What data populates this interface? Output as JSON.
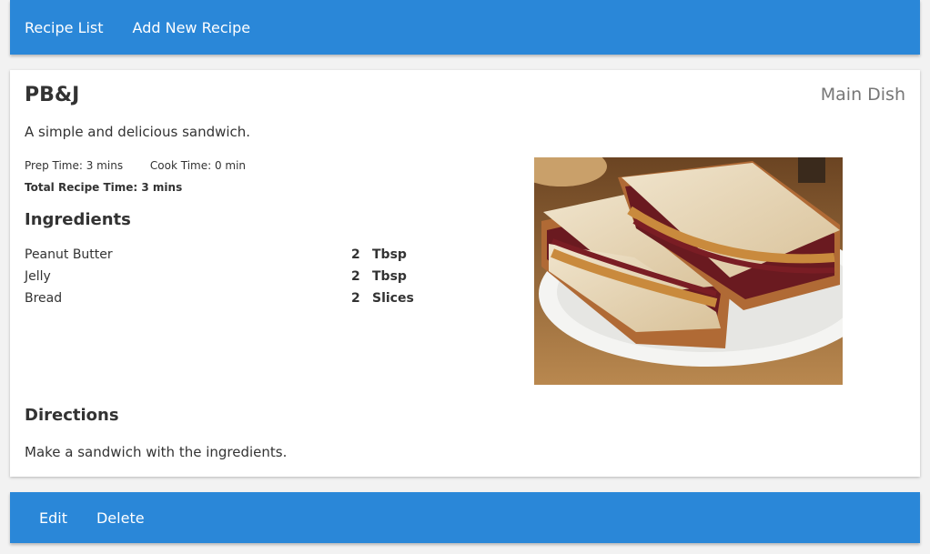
{
  "nav": {
    "items": [
      {
        "label": "Recipe List"
      },
      {
        "label": "Add New Recipe"
      }
    ]
  },
  "recipe": {
    "title": "PB&J",
    "category": "Main Dish",
    "description": "A simple and delicious sandwich.",
    "prep_time": "Prep Time: 3 mins",
    "cook_time": "Cook Time: 0 min",
    "total_time": "Total Recipe Time: 3 mins",
    "ingredients_heading": "Ingredients",
    "ingredients": [
      {
        "name": "Peanut Butter",
        "qty": "2",
        "unit": "Tbsp"
      },
      {
        "name": "Jelly",
        "qty": "2",
        "unit": "Tbsp"
      },
      {
        "name": "Bread",
        "qty": "2",
        "unit": "Slices"
      }
    ],
    "directions_heading": "Directions",
    "directions": "Make a sandwich with the ingredients."
  },
  "actions": {
    "edit_label": "Edit",
    "delete_label": "Delete"
  },
  "colors": {
    "accent": "#2a87d8",
    "text": "#333333",
    "muted": "#777777"
  },
  "icons": {
    "photo": "sandwich-photo"
  }
}
